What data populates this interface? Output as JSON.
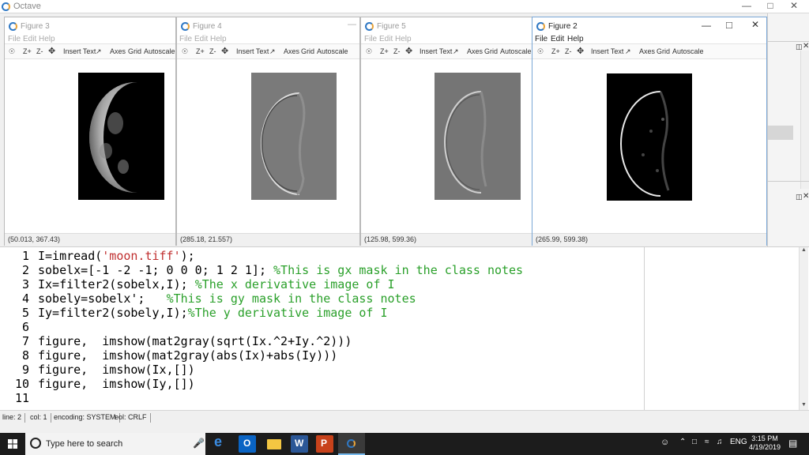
{
  "app": {
    "title": "Octave"
  },
  "figures": [
    {
      "title": "Figure 3",
      "status": "(50.013, 367.43)"
    },
    {
      "title": "Figure 4",
      "status": "(285.18, 21.557)"
    },
    {
      "title": "Figure 5",
      "status": "(125.98, 599.36)"
    },
    {
      "title": "Figure 2",
      "status": "(265.99, 599.38)"
    }
  ],
  "figure_menu": {
    "file": "File",
    "edit": "Edit",
    "help": "Help"
  },
  "figure_toolbar": {
    "zoom_in": "Z+",
    "zoom_out": "Z-",
    "insert_text": "Insert Text",
    "axes": "Axes",
    "grid": "Grid",
    "autoscale": "Autoscale"
  },
  "editor": {
    "line_numbers": [
      "1",
      "2",
      "3",
      "4",
      "5",
      "6",
      "7",
      "8",
      "9",
      "10",
      "11"
    ],
    "lines": [
      {
        "a": "I=imread(",
        "s": "'moon.tiff'",
        "b": ");"
      },
      {
        "a": "sobelx=[-1 -2 -1; 0 0 0; 1 2 1]; ",
        "c": "%This is gx mask in the class notes"
      },
      {
        "a": "Ix=filter2(sobelx,I); ",
        "c": "%The x derivative image of I"
      },
      {
        "a": "sobely=sobelx';   ",
        "c": "%This is gy mask in the class notes"
      },
      {
        "a": "Iy=filter2(sobely,I);",
        "c": "%The y derivative image of I"
      },
      {
        "a": ""
      },
      {
        "a": "figure,  imshow(mat2gray(sqrt(Ix.^2+Iy.^2)))"
      },
      {
        "a": "figure,  imshow(mat2gray(abs(Ix)+abs(Iy)))"
      },
      {
        "a": "figure,  imshow(Ix,[])"
      },
      {
        "a": "figure,  imshow(Iy,[])"
      },
      {
        "a": ""
      }
    ]
  },
  "statusbar": {
    "line": "line: 2",
    "col": "col: 1",
    "encoding": "encoding: SYSTEM",
    "eol": "eol: CRLF"
  },
  "taskbar": {
    "search_placeholder": "Type here to search",
    "lang": "ENG",
    "time": "3:15 PM",
    "date": "4/19/2019"
  }
}
